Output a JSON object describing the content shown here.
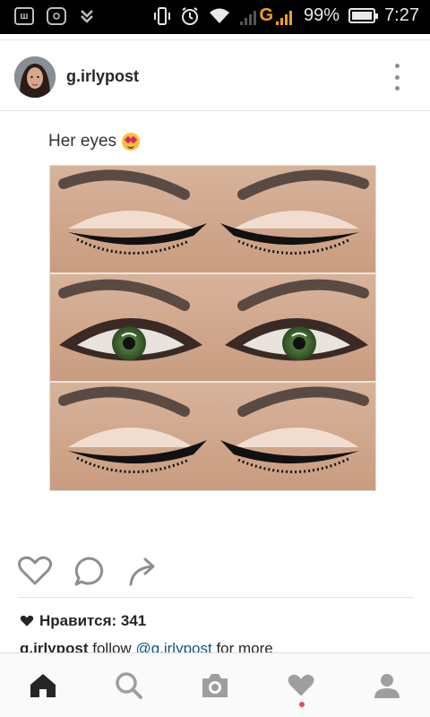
{
  "status_bar": {
    "battery": "99%",
    "battery_level": 0.99,
    "time": "7:27",
    "network": "G",
    "left_icons": [
      "app-w-icon",
      "instagram-icon",
      "download-icon"
    ],
    "right_icons": [
      "vibrate-icon",
      "alarm-icon",
      "wifi-icon",
      "signal-icon",
      "battery-icon"
    ]
  },
  "post": {
    "username": "g.irlypost",
    "image_caption": "Her eyes",
    "image_caption_emoji": "heart-eyes-emoji-icon",
    "likes_label": "Нравится: 341",
    "caption": {
      "user": "g.irlypost",
      "text_before": " follow ",
      "mention": "@g.irlypost",
      "text_after": " for more"
    }
  },
  "actions": [
    "heart-outline-icon",
    "comment-icon",
    "share-arrow-icon"
  ],
  "bottom_nav": {
    "items": [
      "home-icon",
      "search-icon",
      "camera-icon",
      "activity-heart-icon",
      "profile-icon"
    ],
    "active": "home-icon",
    "notification_dot_color": "#ed4956"
  },
  "colors": {
    "text": "#262626",
    "mention": "#125688",
    "icon_gray": "#8e8e8e"
  }
}
